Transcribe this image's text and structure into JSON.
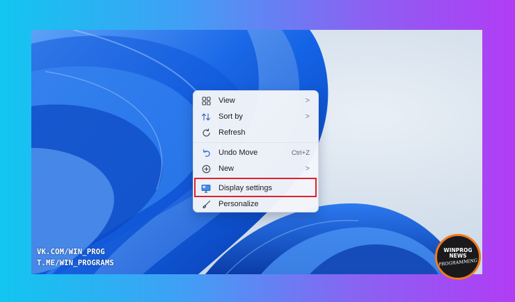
{
  "watermark": {
    "line1": "VK.COM/WIN_PROG",
    "line2": "T.ME/WIN_PROGRAMS"
  },
  "context_menu": {
    "items": [
      {
        "label": "View",
        "icon": "grid-icon",
        "has_submenu": true
      },
      {
        "label": "Sort by",
        "icon": "sort-icon",
        "has_submenu": true
      },
      {
        "label": "Refresh",
        "icon": "refresh-icon",
        "has_submenu": false
      },
      {
        "label": "Undo Move",
        "icon": "undo-icon",
        "shortcut": "Ctrl+Z"
      },
      {
        "label": "New",
        "icon": "new-icon",
        "has_submenu": true
      },
      {
        "label": "Display settings",
        "icon": "display-icon",
        "highlighted": true
      },
      {
        "label": "Personalize",
        "icon": "brush-icon",
        "has_submenu": false
      }
    ],
    "chevron": ">"
  },
  "badge": {
    "line1": "WINPROG",
    "line2": "NEWS",
    "line3": "PROGRAMMING"
  },
  "colors": {
    "highlight_border": "#e0202a",
    "accent_blue": "#0a5fd8",
    "badge_ring": "#f07a1f"
  }
}
